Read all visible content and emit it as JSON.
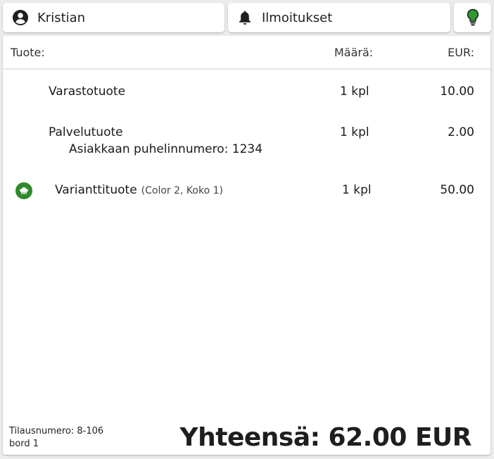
{
  "topbar": {
    "user": {
      "name": "Kristian",
      "icon": "account-circle-icon"
    },
    "notifications": {
      "label": "Ilmoitukset",
      "icon": "bell-icon"
    },
    "tip": {
      "icon": "lightbulb-icon",
      "color": "#2e9a2e"
    }
  },
  "table": {
    "headers": {
      "product": "Tuote:",
      "quantity": "Määrä:",
      "eur": "EUR:"
    },
    "rows": [
      {
        "name": "Varastotuote",
        "qty": "1 kpl",
        "price": "10.00"
      },
      {
        "name": "Palvelutuote",
        "detail": "Asiakkaan puhelinnumero: 1234",
        "qty": "1 kpl",
        "price": "2.00"
      },
      {
        "name": "Varianttituote",
        "variant": "(Color 2, Koko 1)",
        "qty": "1 kpl",
        "price": "50.00",
        "icon": "chef-hat-icon",
        "icon_color": "#2e8a2a"
      }
    ]
  },
  "footer": {
    "order_number": "Tilausnumero: 8-106",
    "table_name": "bord 1",
    "total": "Yhteensä: 62.00 EUR"
  }
}
